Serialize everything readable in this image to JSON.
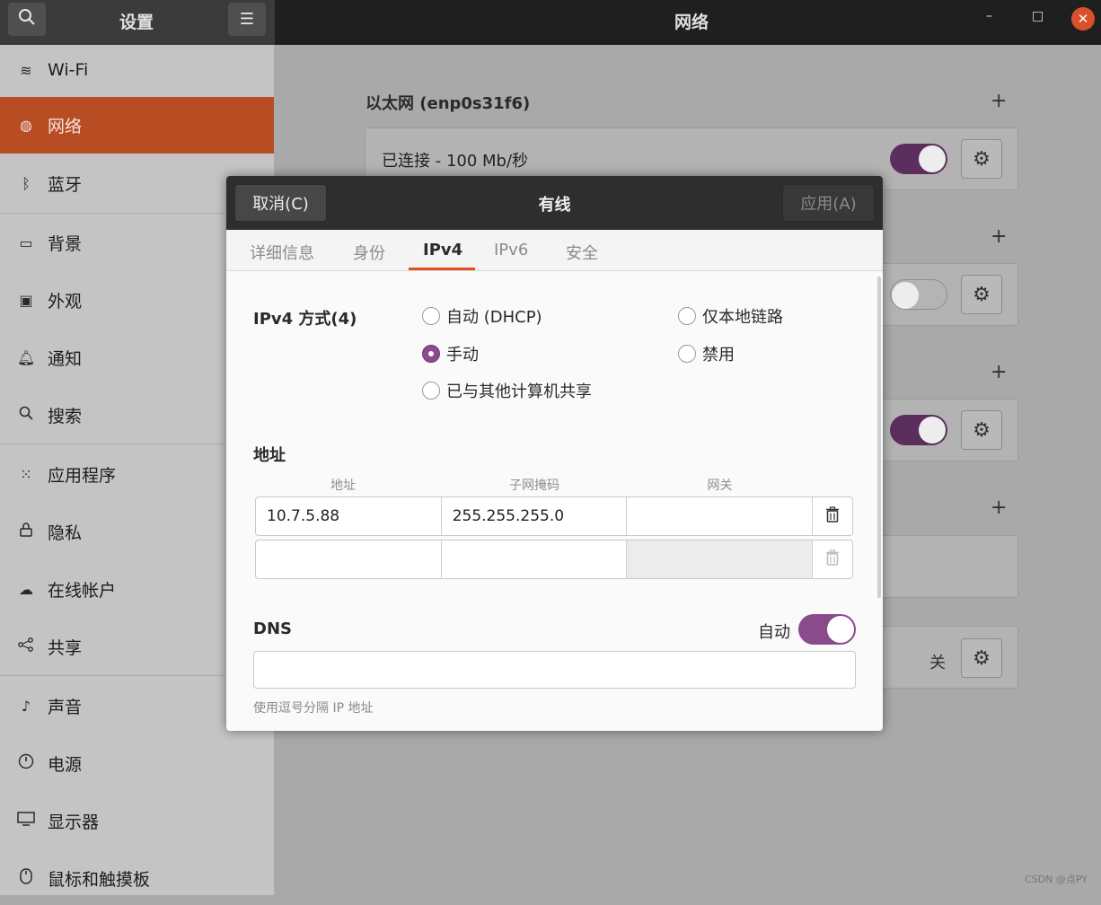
{
  "header": {
    "search_icon": "search-icon",
    "app_title": "设置",
    "menu_icon": "hamburger-icon",
    "panel_title": "网络",
    "minimize": "–",
    "maximize": "□",
    "close": "✕"
  },
  "sidebar": {
    "items": [
      {
        "label": "Wi-Fi",
        "icon": "wifi-icon",
        "glyph": "≋"
      },
      {
        "label": "网络",
        "icon": "network-icon",
        "glyph": "◍"
      },
      {
        "label": "蓝牙",
        "icon": "bluetooth-icon",
        "glyph": "ᛒ"
      },
      {
        "label": "背景",
        "icon": "background-icon",
        "glyph": "▭"
      },
      {
        "label": "外观",
        "icon": "appearance-icon",
        "glyph": "▣"
      },
      {
        "label": "通知",
        "icon": "bell-icon",
        "glyph": "♫"
      },
      {
        "label": "搜索",
        "icon": "search-icon",
        "glyph": "⚲"
      },
      {
        "label": "应用程序",
        "icon": "apps-icon",
        "glyph": "⁙"
      },
      {
        "label": "隐私",
        "icon": "lock-icon",
        "glyph": "🔒"
      },
      {
        "label": "在线帐户",
        "icon": "cloud-icon",
        "glyph": "☁"
      },
      {
        "label": "共享",
        "icon": "share-icon",
        "glyph": "⋖"
      },
      {
        "label": "声音",
        "icon": "music-icon",
        "glyph": "♪"
      },
      {
        "label": "电源",
        "icon": "power-icon",
        "glyph": "⏻"
      },
      {
        "label": "显示器",
        "icon": "display-icon",
        "glyph": "▭"
      },
      {
        "label": "鼠标和触摸板",
        "icon": "mouse-icon",
        "glyph": "▯"
      }
    ],
    "active": "网络"
  },
  "network": {
    "ethernet_title": "以太网 (enp0s31f6)",
    "ethernet_status": "已连接 - 100 Mb/秒",
    "off_label": "关"
  },
  "dialog": {
    "cancel": "取消(C)",
    "title": "有线",
    "apply": "应用(A)",
    "tabs": [
      "详细信息",
      "身份",
      "IPv4",
      "IPv6",
      "安全"
    ],
    "active_tab": "IPv4",
    "method_label": "IPv4 方式(4)",
    "methods": {
      "auto": "自动 (DHCP)",
      "link_local": "仅本地链路",
      "manual": "手动",
      "disabled": "禁用",
      "shared": "已与其他计算机共享"
    },
    "selected_method": "手动",
    "address_section": "地址",
    "columns": [
      "地址",
      "子网掩码",
      "网关"
    ],
    "rows": [
      {
        "address": "10.7.5.88",
        "netmask": "255.255.255.0",
        "gateway": ""
      },
      {
        "address": "",
        "netmask": "",
        "gateway": ""
      }
    ],
    "dns_label": "DNS",
    "dns_auto_label": "自动",
    "dns_auto_on": true,
    "dns_value": "",
    "dns_hint": "使用逗号分隔 IP 地址"
  },
  "watermark": "CSDN @点PY"
}
